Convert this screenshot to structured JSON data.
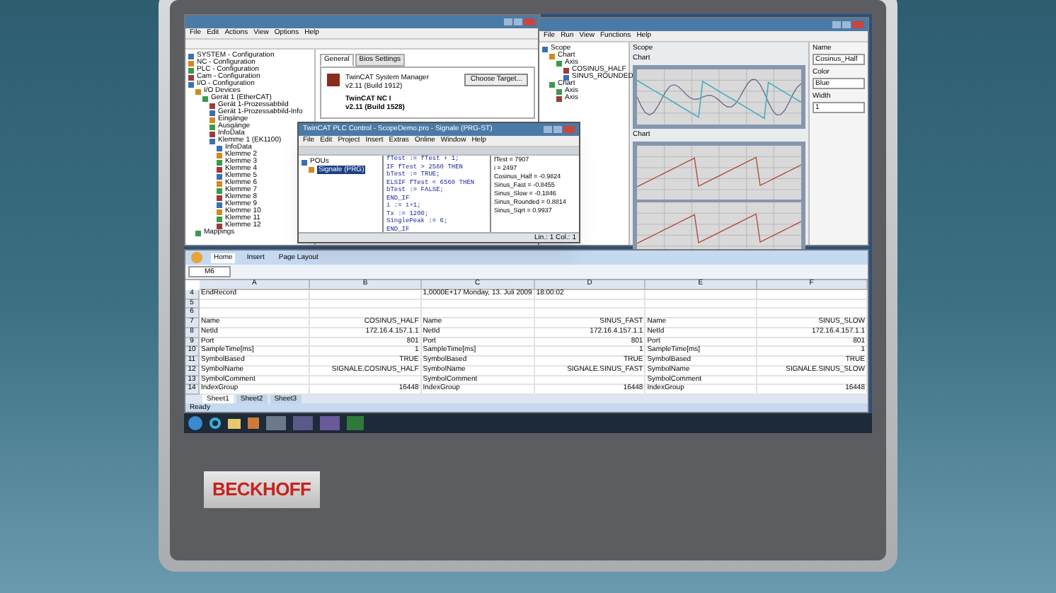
{
  "device": {
    "brand": "BECKHOFF"
  },
  "system_manager": {
    "menu": [
      "File",
      "Edit",
      "Actions",
      "View",
      "Options",
      "Help"
    ],
    "tree": [
      {
        "label": "SYSTEM - Configuration"
      },
      {
        "label": "NC - Configuration"
      },
      {
        "label": "PLC - Configuration"
      },
      {
        "label": "Cam - Configuration"
      },
      {
        "label": "I/O - Configuration",
        "children": [
          {
            "label": "I/O Devices",
            "children": [
              {
                "label": "Gerät 1 (EtherCAT)",
                "children": [
                  {
                    "label": "Gerät 1-Prozessabbild"
                  },
                  {
                    "label": "Gerät 1-Prozessabbild-Info"
                  },
                  {
                    "label": "Eingänge"
                  },
                  {
                    "label": "Ausgänge"
                  },
                  {
                    "label": "InfoData"
                  },
                  {
                    "label": "Klemme 1 (EK1100)",
                    "children": [
                      {
                        "label": "InfoData"
                      },
                      {
                        "label": "Klemme 2"
                      },
                      {
                        "label": "Klemme 3"
                      },
                      {
                        "label": "Klemme 4"
                      },
                      {
                        "label": "Klemme 5"
                      },
                      {
                        "label": "Klemme 6"
                      },
                      {
                        "label": "Klemme 7"
                      },
                      {
                        "label": "Klemme 8"
                      },
                      {
                        "label": "Klemme 9"
                      },
                      {
                        "label": "Klemme 10"
                      },
                      {
                        "label": "Klemme 11"
                      },
                      {
                        "label": "Klemme 12"
                      }
                    ]
                  }
                ]
              }
            ]
          },
          {
            "label": "Mappings"
          }
        ]
      }
    ],
    "tabs": [
      {
        "label": "General",
        "selected": true
      },
      {
        "label": "Bios Settings",
        "selected": false
      }
    ],
    "info": [
      "TwinCAT System Manager",
      "v2.11 (Build 1912)"
    ],
    "product": [
      "TwinCAT NC I",
      "v2.11 (Build 1528)"
    ],
    "button": "Choose Target..."
  },
  "plc": {
    "title": "TwinCAT PLC Control - ScopeDemo.pro - Signale (PRG-ST)",
    "menu": [
      "File",
      "Edit",
      "Project",
      "Insert",
      "Extras",
      "Online",
      "Window",
      "Help"
    ],
    "tree": [
      {
        "label": "POUs",
        "selected": false,
        "children": [
          {
            "label": "Signale (PRG)",
            "selected": true
          }
        ]
      }
    ],
    "watch": [
      "fTest = 7907",
      "i = 2497",
      "Cosinus_Half = -0.9824",
      "Sinus_Fast = -0.8455",
      "Sinus_Slow = -0.1846",
      "Sinus_Rounded = 0.8814",
      "Sinus_Sqrt = 0.9937"
    ],
    "code": [
      "fTest := fTest + 1;",
      "IF fTest > 2560 THEN",
      "bTest := TRUE;",
      "ELSIF fTest < 6560 THEN",
      "bTest := FALSE;",
      "END_IF",
      "i := i+1;",
      "Tx := 1200;",
      "SinglePeak := 6;",
      "END_IF"
    ],
    "status": "Lin.: 1 Col.: 1"
  },
  "scope": {
    "menu": [
      "File",
      "Run",
      "View",
      "Functions",
      "Help"
    ],
    "tree": [
      {
        "label": "Scope",
        "children": [
          {
            "label": "Chart",
            "children": [
              {
                "label": "Axis",
                "children": [
                  {
                    "label": "COSINUS_HALF"
                  },
                  {
                    "label": "SINUS_ROUNDED"
                  }
                ]
              }
            ]
          },
          {
            "label": "Chart",
            "children": [
              {
                "label": "Axis"
              },
              {
                "label": "Axis"
              }
            ]
          }
        ]
      }
    ],
    "tabs": [
      "Scope",
      "Chart",
      "Chart"
    ],
    "properties": [
      {
        "label": "Name",
        "value": "Cosinus_Half"
      },
      {
        "label": "Color",
        "value": "Blue"
      },
      {
        "label": "Width",
        "value": "1"
      }
    ]
  },
  "excel": {
    "ribbon": [
      {
        "label": "Home",
        "selected": true
      },
      {
        "label": "Insert",
        "selected": false
      },
      {
        "label": "Page Layout",
        "selected": false
      }
    ],
    "name_box": "M6",
    "columns": [
      "A",
      "B",
      "C",
      "D",
      "E",
      "F"
    ],
    "rows": [
      {
        "n": "4",
        "cells": [
          "EndRecord",
          null,
          "1,0000E+17 Monday, 13. Juli 2009",
          "18:00:02",
          null,
          null
        ]
      },
      {
        "n": "5"
      },
      {
        "n": "6"
      },
      {
        "n": "7",
        "cells": [
          "Name",
          "COSINUS_HALF",
          "Name",
          "SINUS_FAST",
          "Name",
          "SINUS_SLOW"
        ]
      },
      {
        "n": "8",
        "cells": [
          "NetId",
          "172.16.4.157.1.1",
          "NetId",
          "172.16.4.157.1.1",
          "NetId",
          "172.16.4.157.1.1"
        ]
      },
      {
        "n": "9",
        "cells": [
          "Port",
          "801",
          "Port",
          "801",
          "Port",
          "801"
        ]
      },
      {
        "n": "10",
        "cells": [
          "SampleTime[ms]",
          "1",
          "SampleTime[ms]",
          "1",
          "SampleTime[ms]",
          "1"
        ]
      },
      {
        "n": "11",
        "cells": [
          "SymbolBased",
          "TRUE",
          "SymbolBased",
          "TRUE",
          "SymbolBased",
          "TRUE"
        ]
      },
      {
        "n": "12",
        "cells": [
          "SymbolName",
          "SIGNALE.COSINUS_HALF",
          "SymbolName",
          "SIGNALE.SINUS_FAST",
          "SymbolName",
          "SIGNALE.SINUS_SLOW"
        ]
      },
      {
        "n": "13",
        "cells": [
          "SymbolComment",
          null,
          "SymbolComment",
          null,
          "SymbolComment",
          null
        ]
      },
      {
        "n": "14",
        "cells": [
          "IndexGroup",
          "16448",
          "IndexGroup",
          "16448",
          "IndexGroup",
          "16448"
        ]
      }
    ],
    "sheets": [
      {
        "label": "Sheet1",
        "selected": true
      },
      {
        "label": "Sheet2",
        "selected": false
      },
      {
        "label": "Sheet3",
        "selected": false
      }
    ],
    "status": "Ready"
  }
}
